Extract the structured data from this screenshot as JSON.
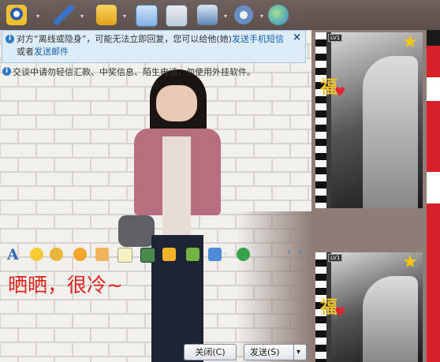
{
  "toolbar": {
    "icons": [
      "video-call-icon",
      "voice-call-icon",
      "send-file-icon",
      "sms-icon",
      "add-app-icon",
      "remote-assist-icon",
      "settings-icon",
      "browser-icon"
    ]
  },
  "notice": {
    "text_before": "对方“离线或隐身”，可能无法立即回复，您可以给他(她)",
    "link1": "发送手机短信",
    "text_mid": "或者",
    "link2": "发送邮件",
    "close": "×"
  },
  "warning": {
    "text": "交谈中请勿轻信汇款、中奖信息、陌生电话，勿使用外挂软件。"
  },
  "format_bar": {
    "font_label": "A"
  },
  "message": {
    "text": "晒晒，很冷~"
  },
  "buttons": {
    "close": "关闭(C)",
    "send": "发送(S)",
    "send_arrow": "▾"
  },
  "profile": {
    "level_top": "LV1",
    "level_bottom": "LV1"
  },
  "colors": {
    "accent_red": "#e0251f",
    "link_blue": "#1760b4",
    "notice_bg": "#dcecf8"
  }
}
